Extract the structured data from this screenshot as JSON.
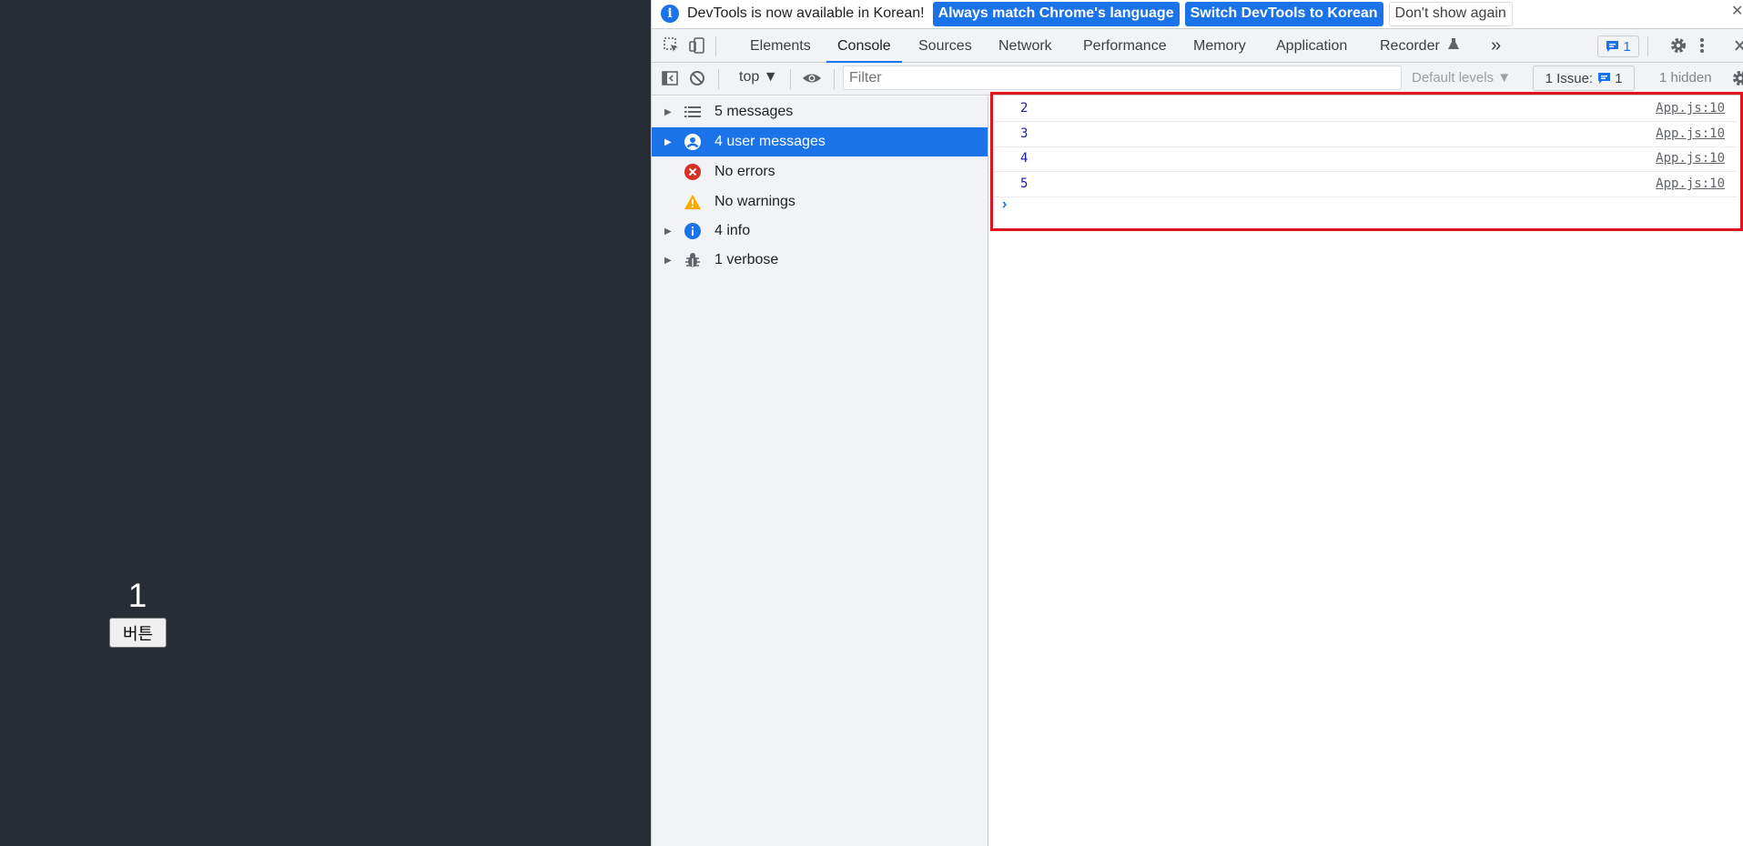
{
  "app": {
    "counter": "1",
    "button_label": "버튼"
  },
  "infobar": {
    "message": "DevTools is now available in Korean!",
    "match_language_btn": "Always match Chrome's language",
    "switch_btn": "Switch DevTools to Korean",
    "dont_show_btn": "Don't show again",
    "close": "✕"
  },
  "tabs": [
    "Elements",
    "Console",
    "Sources",
    "Network",
    "Performance",
    "Memory",
    "Application",
    "Recorder"
  ],
  "active_tab": "Console",
  "tabbar": {
    "more": "»",
    "issues_badge": "1"
  },
  "toolbar": {
    "context": "top ▼",
    "filter_placeholder": "Filter",
    "levels": "Default levels ▼",
    "issues": "1 Issue:",
    "issues_count": "1",
    "hidden": "1 hidden"
  },
  "sidebar": {
    "items": [
      {
        "label": "5 messages",
        "icon": "list-icon",
        "expandable": true
      },
      {
        "label": "4 user messages",
        "icon": "user-icon",
        "expandable": true,
        "active": true
      },
      {
        "label": "No errors",
        "icon": "error-icon",
        "expandable": false
      },
      {
        "label": "No warnings",
        "icon": "warning-icon",
        "expandable": false
      },
      {
        "label": "4 info",
        "icon": "info-icon",
        "expandable": true
      },
      {
        "label": "1 verbose",
        "icon": "bug-icon",
        "expandable": true
      }
    ]
  },
  "console": {
    "logs": [
      {
        "value": "2",
        "source": "App.js:10"
      },
      {
        "value": "3",
        "source": "App.js:10"
      },
      {
        "value": "4",
        "source": "App.js:10"
      },
      {
        "value": "5",
        "source": "App.js:10"
      }
    ],
    "prompt": "›"
  },
  "colors": {
    "accent": "#1a73e8",
    "highlight": "#e0141e",
    "app_background": "#282c34"
  }
}
